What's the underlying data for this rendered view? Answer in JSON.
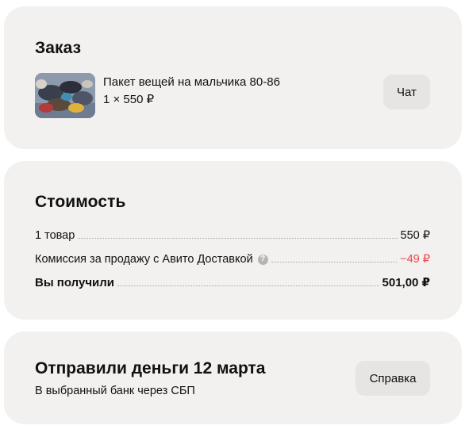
{
  "order": {
    "title": "Заказ",
    "item_name": "Пакет вещей на мальчика 80-86",
    "item_price": "1 × 550 ₽",
    "chat_button": "Чат",
    "thumb_icon": "product-photo"
  },
  "cost": {
    "title": "Стоимость",
    "rows": [
      {
        "label": "1 товар",
        "value": "550 ₽"
      },
      {
        "label": "Комиссия за продажу с Авито Доставкой",
        "value": "−49 ₽",
        "help_icon": "?"
      },
      {
        "label": "Вы получили",
        "value": "501,00 ₽"
      }
    ]
  },
  "payout": {
    "title": "Отправили деньги 12 марта",
    "subtitle": "В выбранный банк через СБП",
    "help_button": "Справка"
  },
  "colors": {
    "card_bg": "#f2f1f0",
    "button_bg": "#e6e5e3",
    "negative": "#e8454b"
  }
}
